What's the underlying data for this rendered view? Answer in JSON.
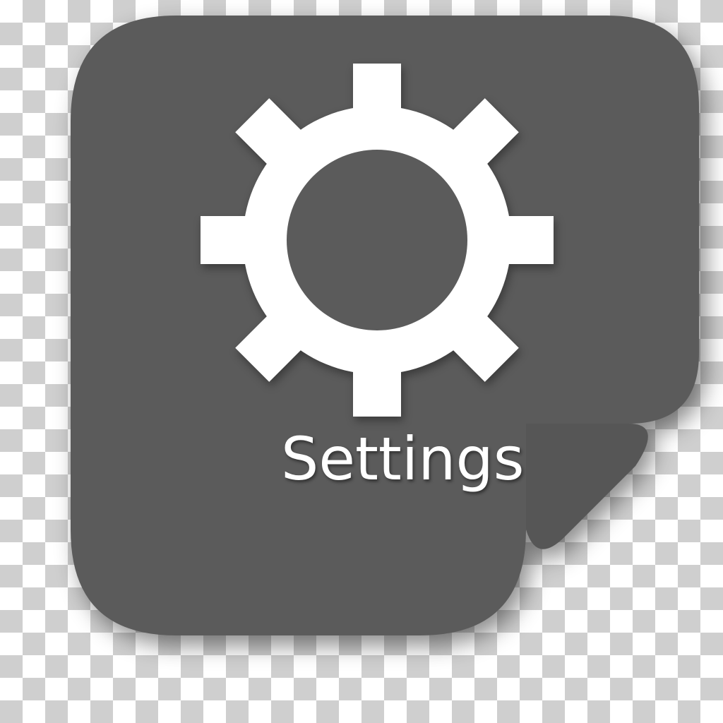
{
  "app": {
    "name": "Settings",
    "icon": "gear-icon"
  },
  "colors": {
    "tile": "#5b5b5b",
    "glyph": "#ffffff",
    "checker_light": "#ffffff",
    "checker_dark": "#cfcfcf"
  }
}
